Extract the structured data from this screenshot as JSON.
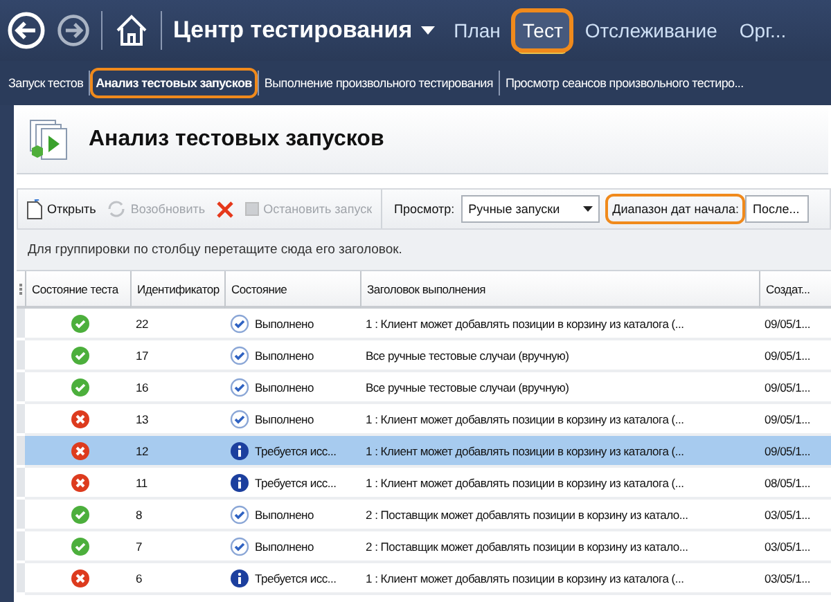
{
  "nav": {
    "title": "Центр тестирования",
    "tabs": [
      {
        "label": "План",
        "selected": false,
        "highlighted": false
      },
      {
        "label": "Тест",
        "selected": true,
        "highlighted": true
      },
      {
        "label": "Отслеживание",
        "selected": false,
        "highlighted": false
      },
      {
        "label": "Орг...",
        "selected": false,
        "highlighted": false
      }
    ]
  },
  "subnav": [
    {
      "label": "Запуск тестов",
      "selected": false,
      "highlighted": false
    },
    {
      "label": "Анализ тестовых запусков",
      "selected": true,
      "highlighted": true
    },
    {
      "label": "Выполнение произвольного тестирования",
      "selected": false,
      "highlighted": false
    },
    {
      "label": "Просмотр сеансов произвольного тестиро...",
      "selected": false,
      "highlighted": false
    }
  ],
  "page_title": "Анализ тестовых запусков",
  "toolbar": {
    "actions": [
      {
        "kind": "open",
        "label": "Открыть",
        "disabled": false
      },
      {
        "kind": "resume",
        "label": "Возобновить",
        "disabled": true
      },
      {
        "kind": "delete",
        "disabled": false
      },
      {
        "kind": "stop",
        "label": "Остановить запуск",
        "disabled": true
      }
    ],
    "view_label": "Просмотр:",
    "view_value": "Ручные запуски",
    "date_label": "Диапазон дат начала:",
    "date_label_highlighted": true,
    "date_value": "После..."
  },
  "group_hint": "Для группировки по столбцу перетащите сюда его заголовок.",
  "table": {
    "columns": [
      "Состояние теста",
      "Идентификатор",
      "Состояние",
      "Заголовок выполнения",
      "Создат..."
    ],
    "rows": [
      {
        "passed": true,
        "id": "22",
        "needs_investigation": false,
        "state": "Выполнено",
        "title": "1 : Клиент может добавлять позиции в корзину из каталога (...",
        "created": "09/05/1...",
        "selected": false
      },
      {
        "passed": true,
        "id": "17",
        "needs_investigation": false,
        "state": "Выполнено",
        "title": "Все ручные тестовые случаи (вручную)",
        "created": "09/05/1...",
        "selected": false
      },
      {
        "passed": true,
        "id": "16",
        "needs_investigation": false,
        "state": "Выполнено",
        "title": "Все ручные тестовые случаи (вручную)",
        "created": "09/05/1...",
        "selected": false
      },
      {
        "passed": false,
        "id": "13",
        "needs_investigation": false,
        "state": "Выполнено",
        "title": "1 : Клиент может добавлять позиции в корзину из каталога (...",
        "created": "09/05/1...",
        "selected": false
      },
      {
        "passed": false,
        "id": "12",
        "needs_investigation": true,
        "state": "Требуется исс...",
        "title": "1 : Клиент может добавлять позиции в корзину из каталога (...",
        "created": "09/05/1...",
        "selected": true
      },
      {
        "passed": false,
        "id": "11",
        "needs_investigation": true,
        "state": "Требуется исс...",
        "title": "1 : Клиент может добавлять позиции в корзину из каталога (...",
        "created": "08/05/1...",
        "selected": false
      },
      {
        "passed": true,
        "id": "8",
        "needs_investigation": false,
        "state": "Выполнено",
        "title": "2 : Поставщик может добавлять позиции в корзину из катало...",
        "created": "03/05/1...",
        "selected": false
      },
      {
        "passed": true,
        "id": "7",
        "needs_investigation": false,
        "state": "Выполнено",
        "title": "2 : Поставщик может добавлять позиции в корзину из катало...",
        "created": "03/05/1...",
        "selected": false
      },
      {
        "passed": false,
        "id": "6",
        "needs_investigation": true,
        "state": "Требуется исс...",
        "title": "1 : Клиент может добавлять позиции в корзину из каталога (...",
        "created": "03/05/1...",
        "selected": false
      }
    ]
  }
}
